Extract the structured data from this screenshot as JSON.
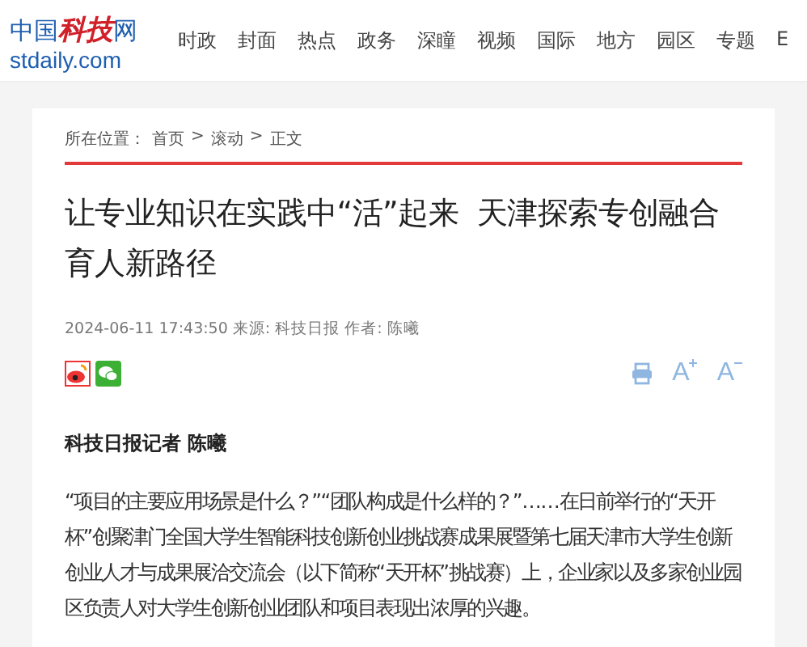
{
  "logo": {
    "prefix": "中国",
    "brand": "科技",
    "suffix": "网",
    "domain": "stdaily.com"
  },
  "nav": [
    "时政",
    "封面",
    "热点",
    "政务",
    "深瞳",
    "视频",
    "国际",
    "地方",
    "园区",
    "专题",
    "E"
  ],
  "breadcrumb": {
    "label": "所在位置：",
    "items": [
      "首页",
      "滚动",
      "正文"
    ],
    "separator": ">"
  },
  "article": {
    "title": "让专业知识在实践中“活”起来  天津探索专创融合育人新路径",
    "meta": "2024-06-11 17:43:50 来源: 科技日报 作者: 陈曦",
    "byline": "科技日报记者  陈曦",
    "paragraph": "“项目的主要应用场景是什么？”“团队构成是什么样的？”……在日前举行的“天开杯”创聚津门全国大学生智能科技创新创业挑战赛成果展暨第七届天津市大学生创新创业人才与成果展洽交流会（以下简称“天开杯”挑战赛）上，企业家以及多家创业园区负责人对大学生创新创业团队和项目表现出浓厚的兴趣。"
  },
  "tools": [
    {
      "kind": "print"
    },
    {
      "kind": "font-up",
      "label": "A"
    },
    {
      "kind": "font-down",
      "label": "A"
    }
  ]
}
